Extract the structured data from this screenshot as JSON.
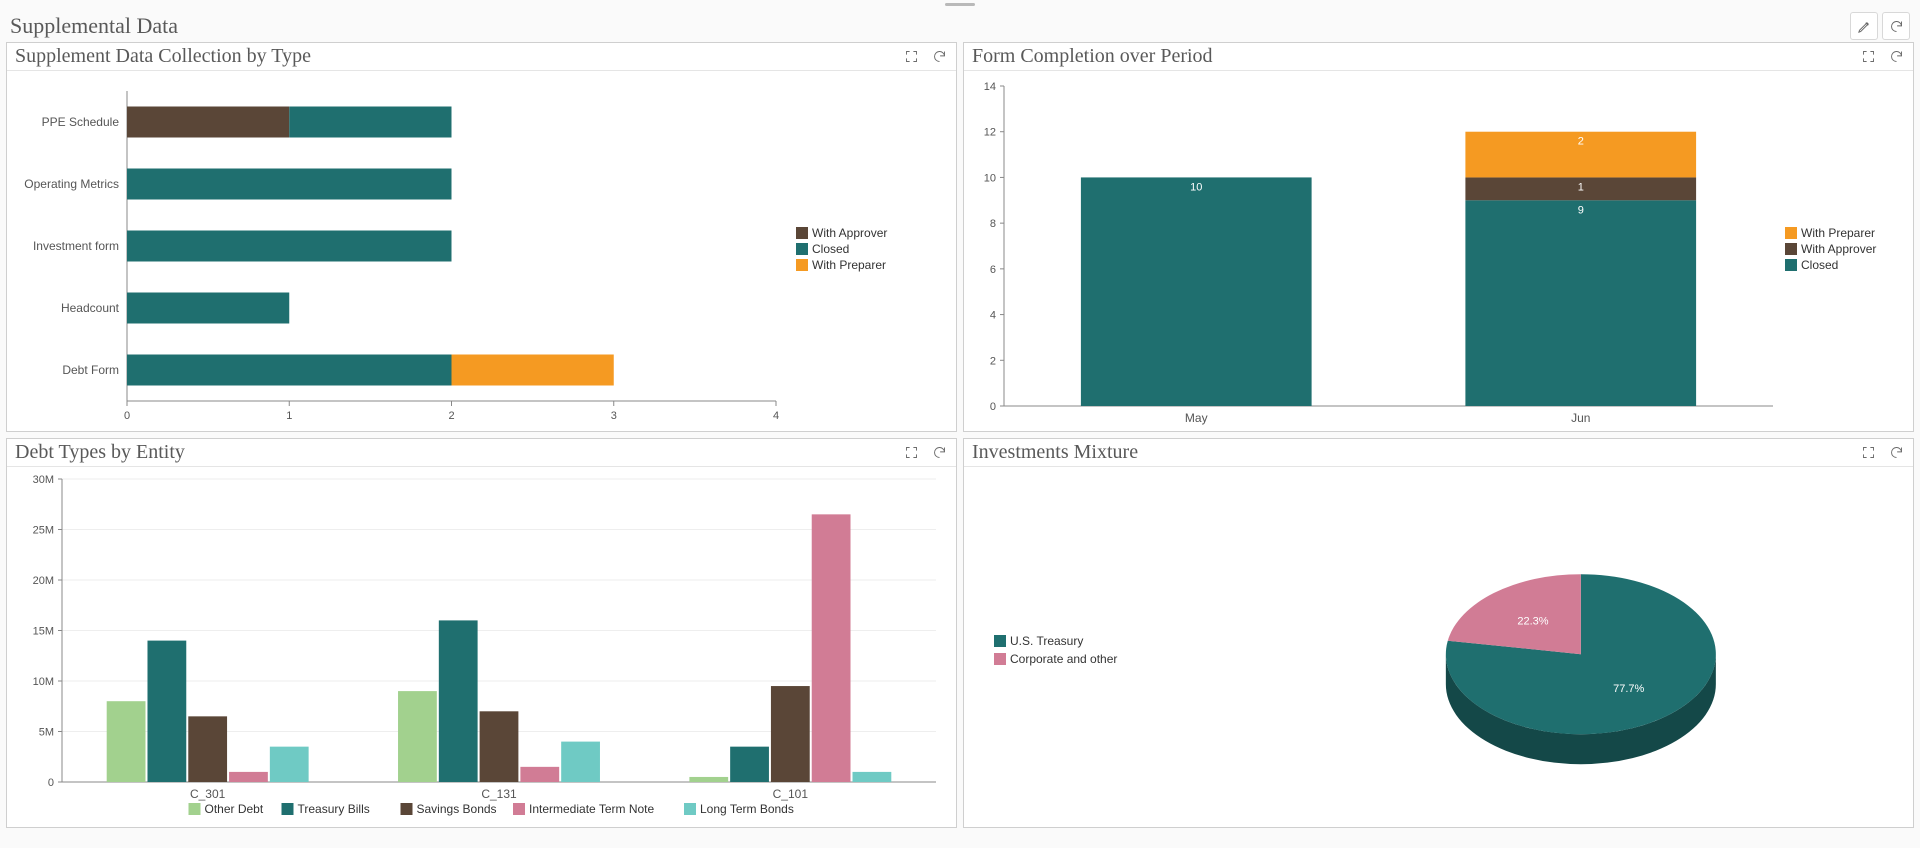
{
  "dashboard": {
    "title": "Supplemental Data"
  },
  "palette": {
    "closed": "#1f6f6f",
    "withApprover": "#5a4637",
    "withPreparer": "#f59a22",
    "otherDebt": "#a2d18e",
    "treasuryBills": "#1f6f6f",
    "savingsBonds": "#5a4637",
    "intermediateNote": "#d17c95",
    "longTermBonds": "#6fcac4",
    "pieA": "#1f6f6f",
    "pieB": "#d17c95"
  },
  "panels": {
    "p1": {
      "title": "Supplement Data Collection by Type"
    },
    "p2": {
      "title": "Form Completion over Period"
    },
    "p3": {
      "title": "Debt Types by Entity"
    },
    "p4": {
      "title": "Investments Mixture"
    }
  },
  "chart_data": [
    {
      "id": "p1",
      "type": "bar",
      "orientation": "horizontal",
      "stacked": true,
      "categories": [
        "PPE Schedule",
        "Operating Metrics",
        "Investment form",
        "Headcount",
        "Debt Form"
      ],
      "series": [
        {
          "name": "With Approver",
          "colorKey": "withApprover",
          "values": [
            1,
            0,
            0,
            0,
            0
          ]
        },
        {
          "name": "Closed",
          "colorKey": "closed",
          "values": [
            1,
            2,
            2,
            1,
            2
          ]
        },
        {
          "name": "With Preparer",
          "colorKey": "withPreparer",
          "values": [
            0,
            0,
            0,
            0,
            1
          ]
        }
      ],
      "xlim": [
        0,
        4
      ],
      "xticks": [
        0,
        1,
        2,
        3,
        4
      ],
      "legend": [
        "With Approver",
        "Closed",
        "With Preparer"
      ]
    },
    {
      "id": "p2",
      "type": "bar",
      "orientation": "vertical",
      "stacked": true,
      "categories": [
        "May",
        "Jun"
      ],
      "series": [
        {
          "name": "With Preparer",
          "colorKey": "withPreparer",
          "values": [
            0,
            2
          ]
        },
        {
          "name": "With Approver",
          "colorKey": "withApprover",
          "values": [
            0,
            1
          ]
        },
        {
          "name": "Closed",
          "colorKey": "closed",
          "values": [
            10,
            9
          ]
        }
      ],
      "ylim": [
        0,
        14
      ],
      "yticks": [
        0,
        2,
        4,
        6,
        8,
        10,
        12,
        14
      ],
      "legend": [
        "With Preparer",
        "With Approver",
        "Closed"
      ],
      "dataLabels": {
        "May": {
          "Closed": "10"
        },
        "Jun": {
          "Closed": "9",
          "With Approver": "1",
          "With Preparer": "2"
        }
      }
    },
    {
      "id": "p3",
      "type": "bar",
      "orientation": "vertical",
      "grouped": true,
      "categories": [
        "C_301",
        "C_131",
        "C_101"
      ],
      "series": [
        {
          "name": "Other Debt",
          "colorKey": "otherDebt",
          "values": [
            8000000,
            9000000,
            500000
          ]
        },
        {
          "name": "Treasury Bills",
          "colorKey": "treasuryBills",
          "values": [
            14000000,
            16000000,
            3500000
          ]
        },
        {
          "name": "Savings Bonds",
          "colorKey": "savingsBonds",
          "values": [
            6500000,
            7000000,
            9500000
          ]
        },
        {
          "name": "Intermediate Term Note",
          "colorKey": "intermediateNote",
          "values": [
            1000000,
            1500000,
            26500000
          ]
        },
        {
          "name": "Long Term Bonds",
          "colorKey": "longTermBonds",
          "values": [
            3500000,
            4000000,
            1000000
          ]
        }
      ],
      "ylim": [
        0,
        30000000
      ],
      "yticks": [
        0,
        5000000,
        10000000,
        15000000,
        20000000,
        25000000,
        30000000
      ],
      "ytick_labels": [
        "0",
        "5M",
        "10M",
        "15M",
        "20M",
        "25M",
        "30M"
      ],
      "legend": [
        "Other Debt",
        "Treasury Bills",
        "Savings Bonds",
        "Intermediate Term Note",
        "Long Term Bonds"
      ]
    },
    {
      "id": "p4",
      "type": "pie",
      "series": [
        {
          "name": "U.S. Treasury",
          "colorKey": "pieA",
          "value": 77.7,
          "label": "77.7%"
        },
        {
          "name": "Corporate and other",
          "colorKey": "pieB",
          "value": 22.3,
          "label": "22.3%"
        }
      ],
      "legend": [
        "U.S. Treasury",
        "Corporate and other"
      ]
    }
  ]
}
